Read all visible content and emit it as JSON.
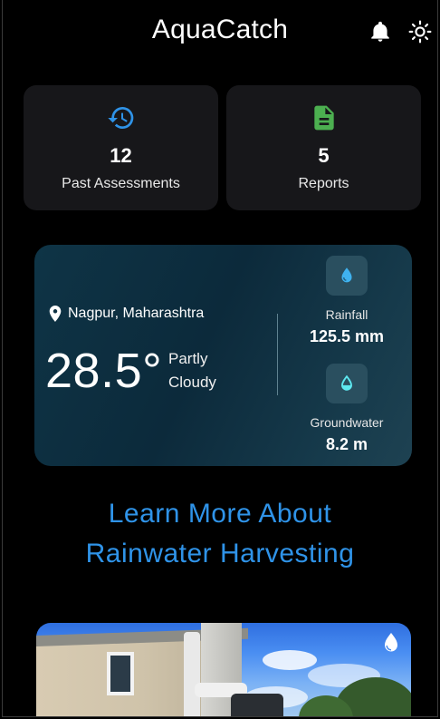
{
  "header": {
    "title": "AquaCatch",
    "icons": [
      "bell-icon",
      "sun-icon"
    ]
  },
  "stats": [
    {
      "icon": "history-icon",
      "value": "12",
      "label": "Past Assessments",
      "color": "#2f93e8"
    },
    {
      "icon": "document-icon",
      "value": "5",
      "label": "Reports",
      "color": "#4caf50"
    }
  ],
  "weather": {
    "location": "Nagpur, Maharashtra",
    "temperature": "28.5°",
    "condition": "Partly Cloudy",
    "rainfall": {
      "label": "Rainfall",
      "value": "125.5 mm",
      "icon": "water-drop-icon"
    },
    "groundwater": {
      "label": "Groundwater",
      "value": "8.2 m",
      "icon": "water-drop-outline-icon"
    }
  },
  "learn": {
    "line1": "Learn More About",
    "line2": "Rainwater Harvesting"
  },
  "colors": {
    "accent": "#2f93e8",
    "card": "#17171a",
    "weather_bg": "#0e3446",
    "report_green": "#4caf50",
    "drop_blue": "#3fb2ef",
    "drop_cyan": "#5ee8f0"
  }
}
